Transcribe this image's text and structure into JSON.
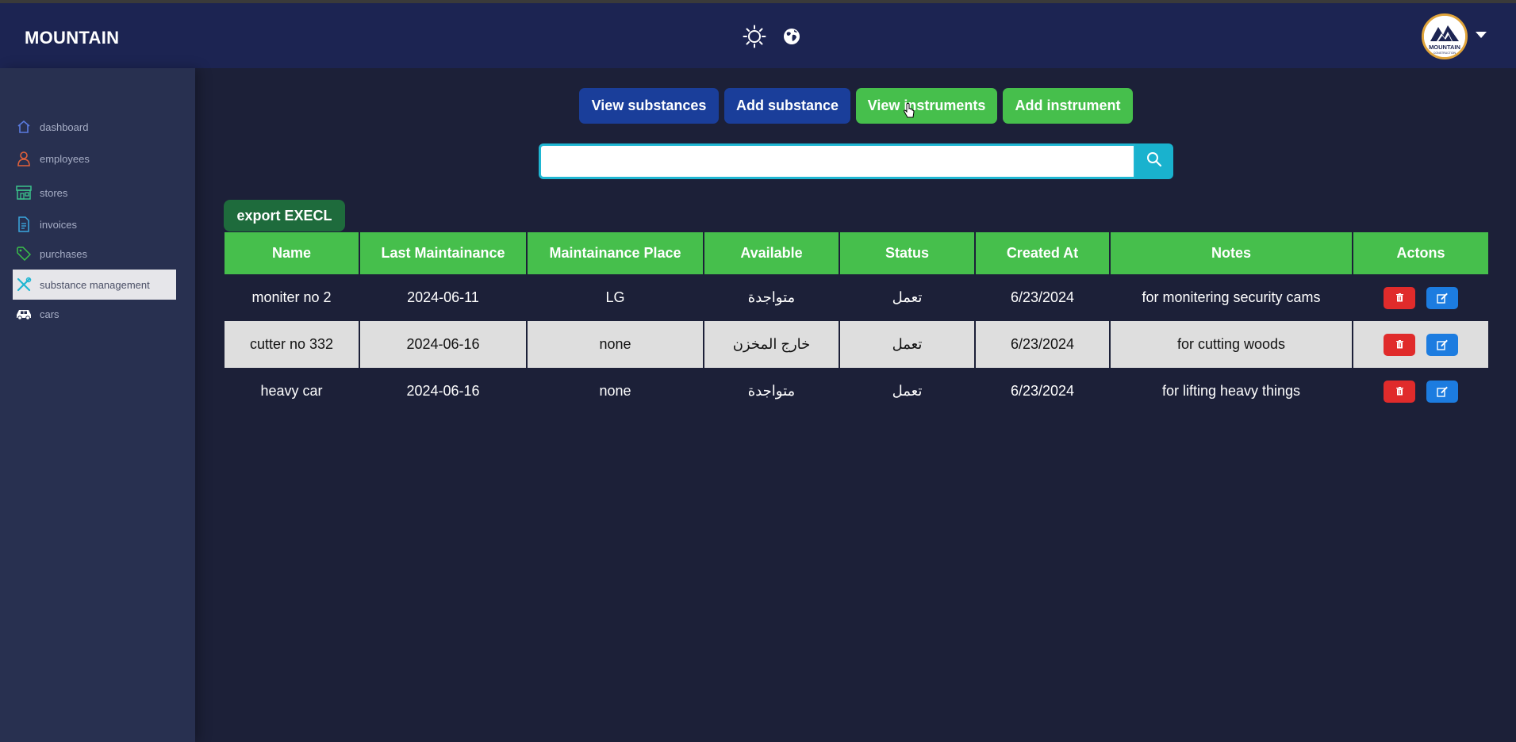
{
  "header": {
    "brand": "MOUNTAIN",
    "sun_icon": "sun-icon",
    "globe_icon": "globe-icon",
    "avatar_logo_text": "MOUNTAIN"
  },
  "sidebar": {
    "items": [
      {
        "label": "dashboard",
        "icon": "home-icon",
        "color": "#5a7be0"
      },
      {
        "label": "employees",
        "icon": "user-icon",
        "color": "#e0603a"
      },
      {
        "label": "stores",
        "icon": "store-icon",
        "color": "#3ac18a"
      },
      {
        "label": "invoices",
        "icon": "file-icon",
        "color": "#3aa8e0"
      },
      {
        "label": "purchases",
        "icon": "tag-icon",
        "color": "#3ac14a"
      },
      {
        "label": "substance management",
        "icon": "tools-icon",
        "color": "#1fb6d2",
        "active": true
      },
      {
        "label": "cars",
        "icon": "car-icon",
        "color": "#ffffff"
      }
    ]
  },
  "tabs": {
    "view_substances": "View substances",
    "add_substance": "Add substance",
    "view_instruments": "View instruments",
    "add_instrument": "Add instrument"
  },
  "search": {
    "value": "",
    "placeholder": ""
  },
  "export_label": "export EXECL",
  "table": {
    "columns": [
      "Name",
      "Last Maintainance",
      "Maintainance Place",
      "Available",
      "Status",
      "Created At",
      "Notes",
      "Actons"
    ],
    "rows": [
      {
        "name": "moniter no 2",
        "last": "2024-06-11",
        "place": "LG",
        "available": "متواجدة",
        "status": "تعمل",
        "created": "6/23/2024",
        "notes": "for monitering security cams"
      },
      {
        "name": "cutter no 332",
        "last": "2024-06-16",
        "place": "none",
        "available": "خارج المخزن",
        "status": "تعمل",
        "created": "6/23/2024",
        "notes": "for cutting woods"
      },
      {
        "name": "heavy car",
        "last": "2024-06-16",
        "place": "none",
        "available": "متواجدة",
        "status": "تعمل",
        "created": "6/23/2024",
        "notes": "for lifting heavy things"
      }
    ]
  },
  "colors": {
    "header_bg": "#1c2452",
    "page_bg": "#1c2038",
    "sidebar_bg": "#283050",
    "tab_blue": "#1a3e9a",
    "tab_green": "#46bf4c",
    "table_header": "#46bf4c",
    "available_green": "#2e9e33",
    "available_red": "#e22020",
    "delete": "#e02b2b",
    "edit": "#1c7ce0"
  }
}
